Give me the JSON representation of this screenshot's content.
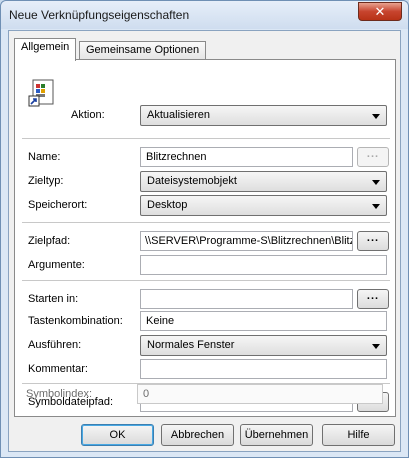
{
  "window": {
    "title": "Neue Verknüpfungseigenschaften",
    "close_glyph": "✕"
  },
  "tabs": [
    {
      "label": "Allgemein",
      "active": true
    },
    {
      "label": "Gemeinsame Optionen",
      "active": false
    }
  ],
  "action": {
    "label": "Aktion:",
    "value": "Aktualisieren",
    "icon": "shortcut-icon"
  },
  "name": {
    "label": "Name:",
    "value": "Blitzrechnen",
    "browse": "..."
  },
  "target_type": {
    "label": "Zieltyp:",
    "value": "Dateisystemobjekt"
  },
  "location": {
    "label": "Speicherort:",
    "value": "Desktop"
  },
  "target_path": {
    "label": "Zielpfad:",
    "value": "\\\\SERVER\\Programme-S\\Blitzrechnen\\Blitzre",
    "browse": "..."
  },
  "arguments": {
    "label": "Argumente:",
    "value": ""
  },
  "start_in": {
    "label": "Starten in:",
    "value": "",
    "browse": "..."
  },
  "hotkey": {
    "label": "Tastenkombination:",
    "value": "Keine"
  },
  "run": {
    "label": "Ausführen:",
    "value": "Normales Fenster"
  },
  "comment": {
    "label": "Kommentar:",
    "value": ""
  },
  "icon_path": {
    "label": "Symboldateipfad:",
    "value": "",
    "browse": "..."
  },
  "icon_index": {
    "label": "Symbolindex:",
    "value": "0"
  },
  "buttons": {
    "ok": "OK",
    "cancel": "Abbrechen",
    "apply": "Übernehmen",
    "help": "Hilfe"
  },
  "colors": {
    "title_bar": "#dbe7f5",
    "close_button": "#c7442e",
    "default_button_border": "#3c7fb1"
  }
}
